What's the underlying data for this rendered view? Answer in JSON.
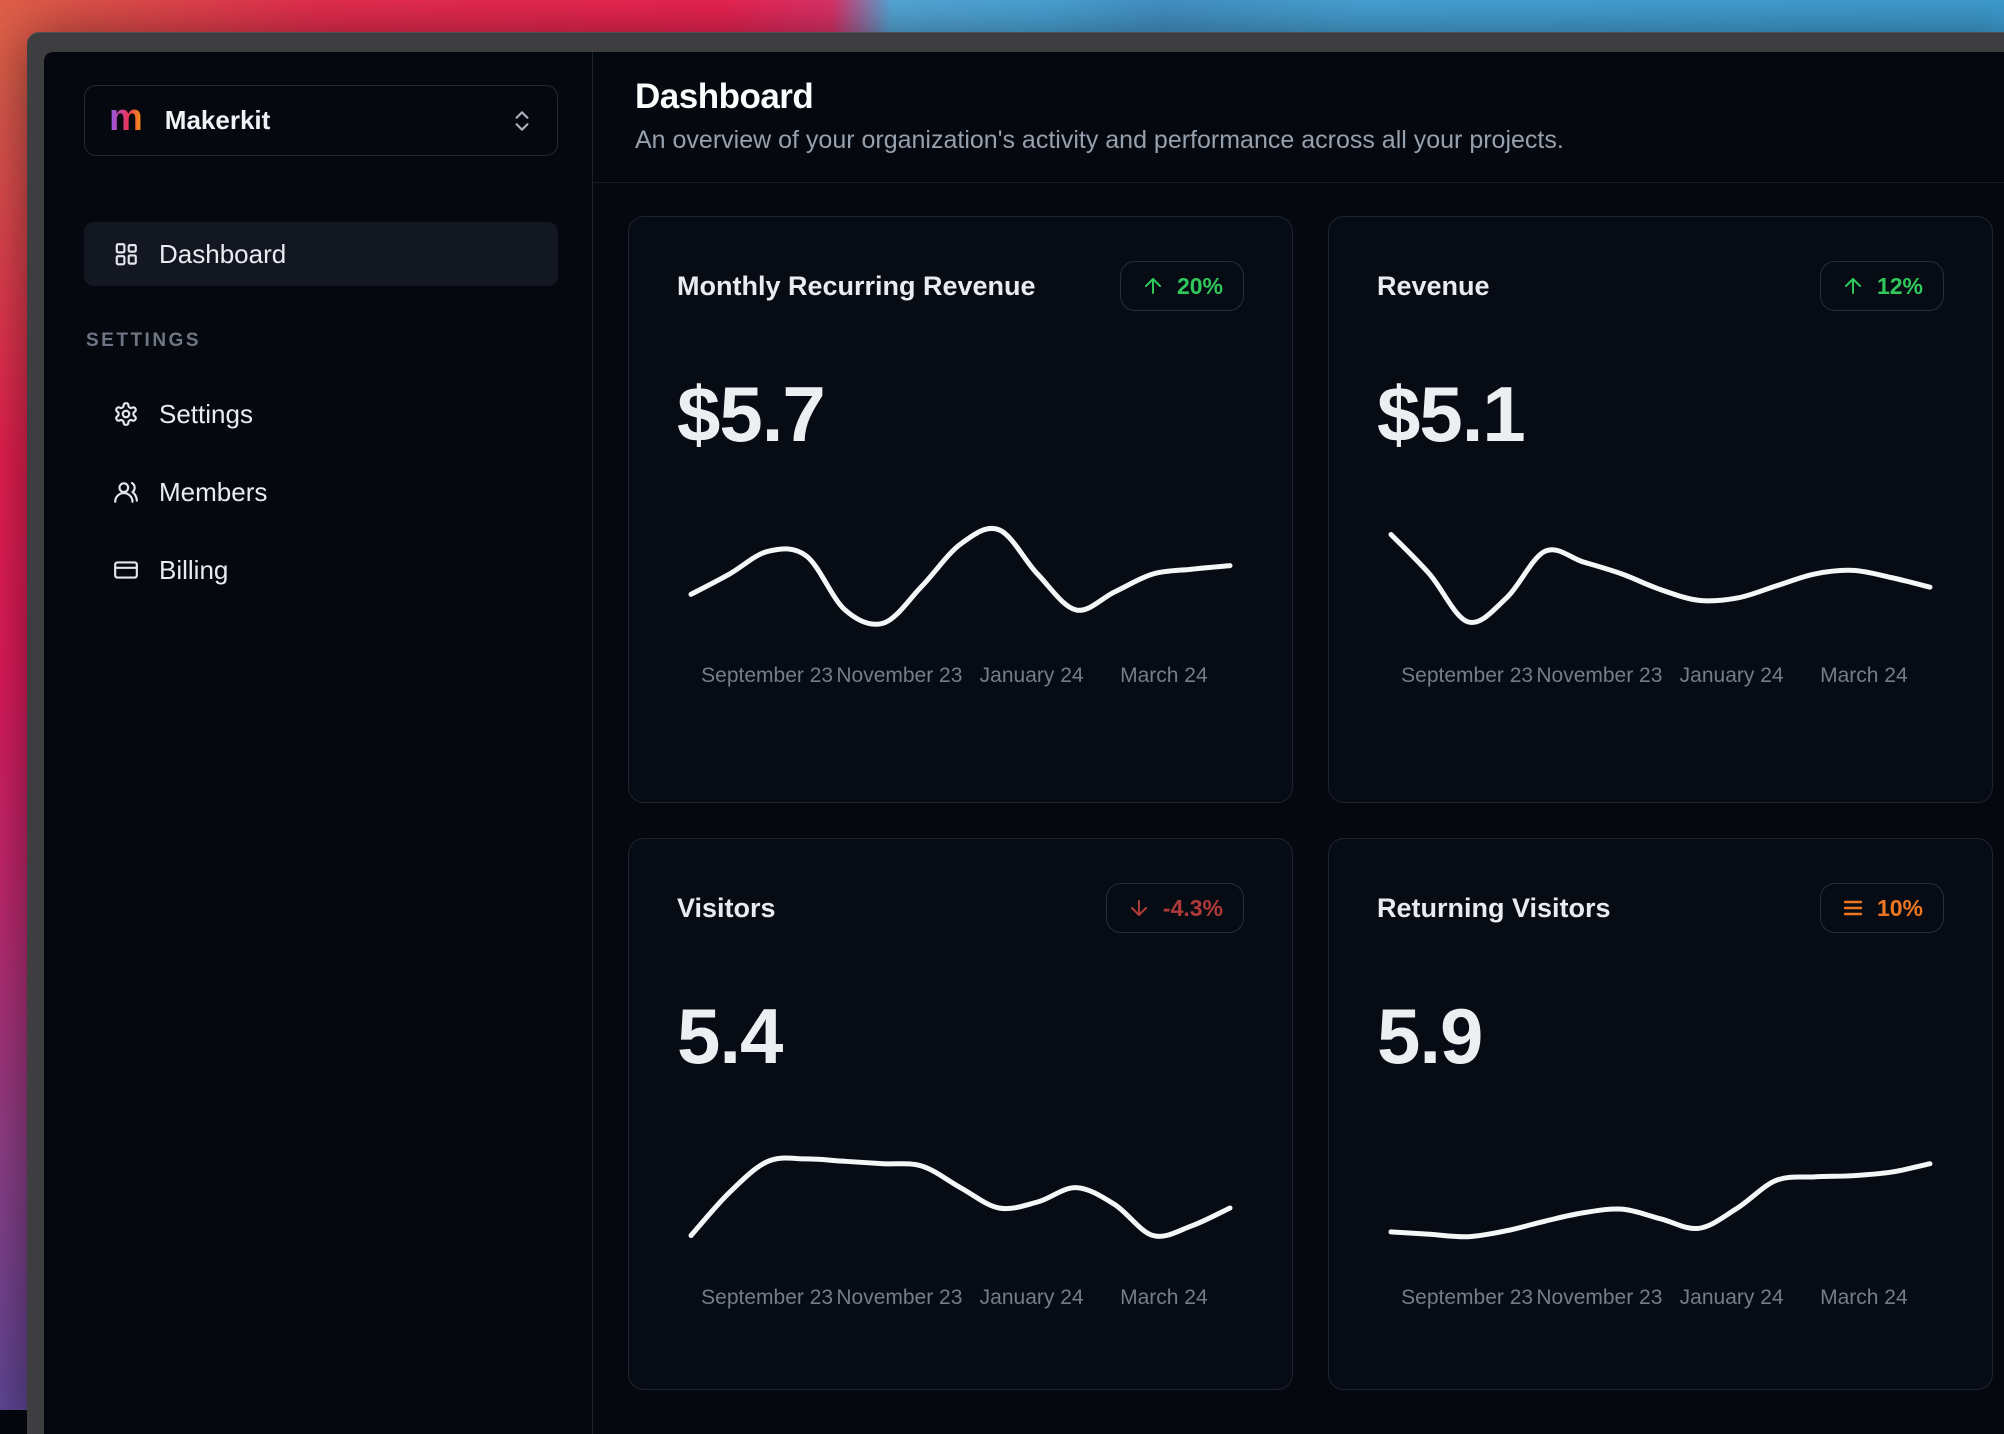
{
  "window": {
    "chrome_color": "#3e3e41"
  },
  "sidebar": {
    "workspace_selector": {
      "name": "Makerkit",
      "logo_letter": "m",
      "logo_gradient": [
        "#8b5cf6",
        "#e8345a",
        "#f59e0b"
      ],
      "chevron_icon": "chevrons-up-down"
    },
    "primary_nav": [
      {
        "label": "Dashboard",
        "icon": "layout-dashboard-icon",
        "active": true
      }
    ],
    "settings_section": {
      "label": "SETTINGS",
      "items": [
        {
          "label": "Settings",
          "icon": "gear-icon"
        },
        {
          "label": "Members",
          "icon": "users-icon"
        },
        {
          "label": "Billing",
          "icon": "credit-card-icon"
        }
      ]
    }
  },
  "header": {
    "title": "Dashboard",
    "subtitle": "An overview of your organization's activity and performance across all your projects."
  },
  "theme": {
    "app_bg": "#05080f",
    "card_bg": "#070b13",
    "card_border": "#1d2433",
    "positive_color": "#30c75b",
    "negative_color": "#b03a3a",
    "neutral_color": "#ed7620",
    "line_color": "#f5f6f8",
    "tick_color": "#757d89"
  },
  "chart_data": [
    {
      "type": "line",
      "title": "Monthly Recurring Revenue",
      "value": "$5.7",
      "badge": {
        "icon": "arrow-up-icon",
        "label": "20%",
        "color": "#30c75b",
        "direction": "up"
      },
      "x_ticks": [
        "September 23",
        "November 23",
        "January 24",
        "March 24"
      ],
      "ylim": [
        0,
        100
      ],
      "grid": false,
      "legend": false,
      "points": [
        38,
        55,
        74,
        70,
        25,
        14,
        45,
        80,
        92,
        55,
        25,
        40,
        55,
        59,
        62
      ]
    },
    {
      "type": "line",
      "title": "Revenue",
      "value": "$5.1",
      "badge": {
        "icon": "arrow-up-icon",
        "label": "12%",
        "color": "#30c75b",
        "direction": "up"
      },
      "x_ticks": [
        "September 23",
        "November 23",
        "January 24",
        "March 24"
      ],
      "ylim": [
        0,
        100
      ],
      "grid": false,
      "legend": false,
      "points": [
        88,
        55,
        15,
        35,
        74,
        65,
        55,
        42,
        33,
        35,
        45,
        55,
        58,
        52,
        44
      ]
    },
    {
      "type": "line",
      "title": "Visitors",
      "value": "5.4",
      "badge": {
        "icon": "arrow-down-icon",
        "label": "-4.3%",
        "color": "#b03a3a",
        "direction": "down"
      },
      "x_ticks": [
        "September 23",
        "November 23",
        "January 24",
        "March 24"
      ],
      "ylim": [
        0,
        100
      ],
      "grid": false,
      "legend": false,
      "points": [
        22,
        58,
        84,
        86,
        84,
        82,
        80,
        62,
        45,
        50,
        62,
        48,
        22,
        30,
        45
      ]
    },
    {
      "type": "line",
      "title": "Returning Visitors",
      "value": "5.9",
      "badge": {
        "icon": "menu-icon",
        "label": "10%",
        "color": "#ed7620",
        "direction": "neutral"
      },
      "x_ticks": [
        "September 23",
        "November 23",
        "January 24",
        "March 24"
      ],
      "ylim": [
        0,
        100
      ],
      "grid": false,
      "legend": false,
      "points": [
        25,
        23,
        21,
        26,
        34,
        41,
        44,
        36,
        28,
        45,
        68,
        71,
        72,
        75,
        82
      ]
    }
  ]
}
